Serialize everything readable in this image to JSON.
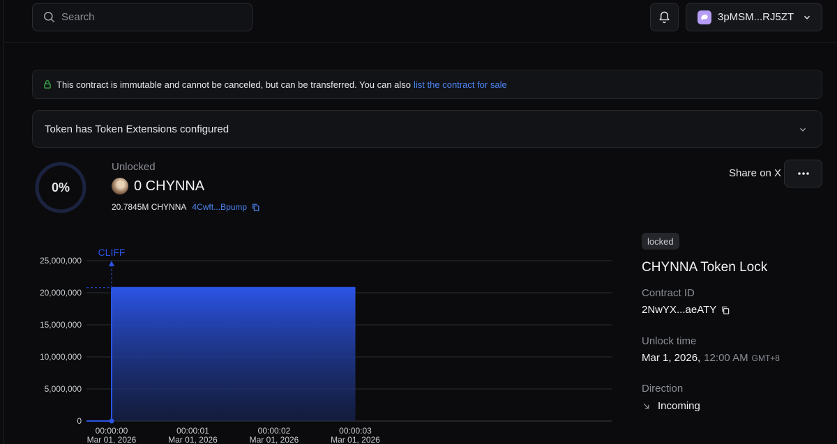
{
  "header": {
    "search_placeholder": "Search",
    "wallet_label": "3pMSM...RJ5ZT"
  },
  "notice": {
    "text": "This contract is immutable and cannot be canceled, but can be transferred.  You can also",
    "link": "list the contract for sale"
  },
  "extensions": {
    "label": "Token has Token Extensions configured"
  },
  "summary": {
    "percent": "0%",
    "percent_value": 0,
    "unlocked_label": "Unlocked",
    "amount": "0 CHYNNA",
    "total": "20.7845M CHYNNA",
    "mint_address": "4Cwft...Bpump",
    "share_label": "Share on X"
  },
  "details": {
    "badge": "locked",
    "title": "CHYNNA Token Lock",
    "contract_id_label": "Contract ID",
    "contract_id": "2NwYX...aeATY",
    "unlock_time_label": "Unlock time",
    "unlock_date": "Mar 1, 2026,",
    "unlock_clock": "12:00 AM",
    "unlock_tz": "GMT+8",
    "direction_label": "Direction",
    "direction": "Incoming"
  },
  "colors": {
    "accent": "#4d86f7",
    "chart_blue": "#2b54e6",
    "background": "#0b0b0d"
  },
  "chart_data": {
    "type": "area",
    "cliff_label": "CLIFF",
    "y_ticks": [
      "25,000,000",
      "20,000,000",
      "15,000,000",
      "10,000,000",
      "5,000,000",
      "0"
    ],
    "y_tick_values": [
      25000000,
      20000000,
      15000000,
      10000000,
      5000000,
      0
    ],
    "ylim": [
      0,
      25000000
    ],
    "x_ticks": [
      {
        "time": "00:00:00",
        "date": "Mar 01, 2026"
      },
      {
        "time": "00:00:01",
        "date": "Mar 01, 2026"
      },
      {
        "time": "00:00:02",
        "date": "Mar 01, 2026"
      },
      {
        "time": "00:00:03",
        "date": "Mar 01, 2026"
      }
    ],
    "x": [
      0,
      3
    ],
    "y": [
      20784500,
      20784500
    ],
    "cliff_x": 0,
    "grid": true
  }
}
